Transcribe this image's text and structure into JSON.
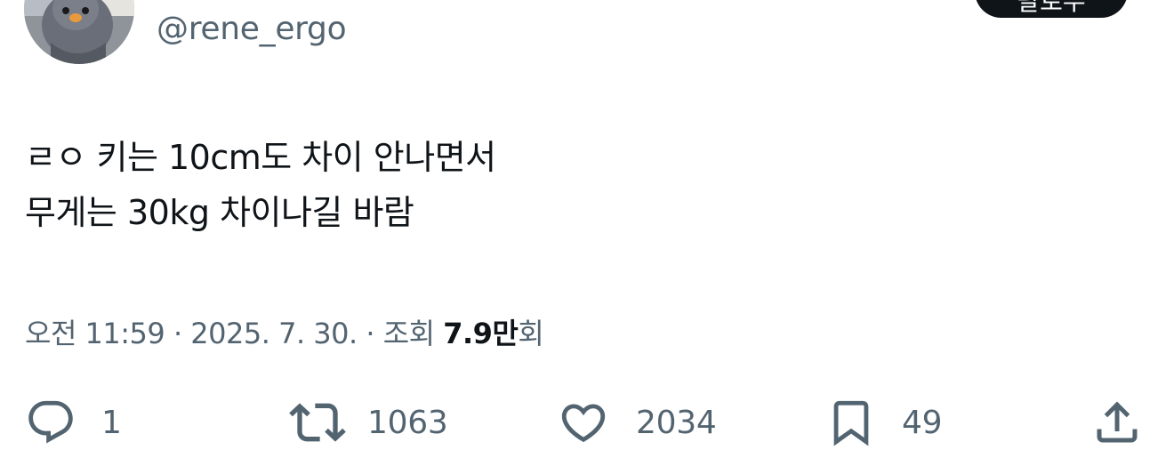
{
  "header": {
    "handle": "@rene_ergo",
    "avatar": "avatar-bird-plush-image",
    "top_button_label": "팔로우"
  },
  "tweet": {
    "lines": [
      "ㄹㅇ 키는 10cm도 차이 안나면서",
      "무게는 30kg 차이나길 바람"
    ]
  },
  "meta": {
    "time": "오전 11:59",
    "separator": "·",
    "date": "2025. 7. 30.",
    "views_prefix": "조회",
    "views_count": "7.9만",
    "views_suffix": "회"
  },
  "actions": {
    "reply": {
      "icon": "reply-icon",
      "count": "1"
    },
    "retweet": {
      "icon": "retweet-icon",
      "count": "1063"
    },
    "like": {
      "icon": "heart-icon",
      "count": "2034"
    },
    "bookmark": {
      "icon": "bookmark-icon",
      "count": "49"
    },
    "share": {
      "icon": "share-icon"
    }
  },
  "colors": {
    "text_primary": "#0f1419",
    "text_secondary": "#536471",
    "background": "#ffffff"
  }
}
